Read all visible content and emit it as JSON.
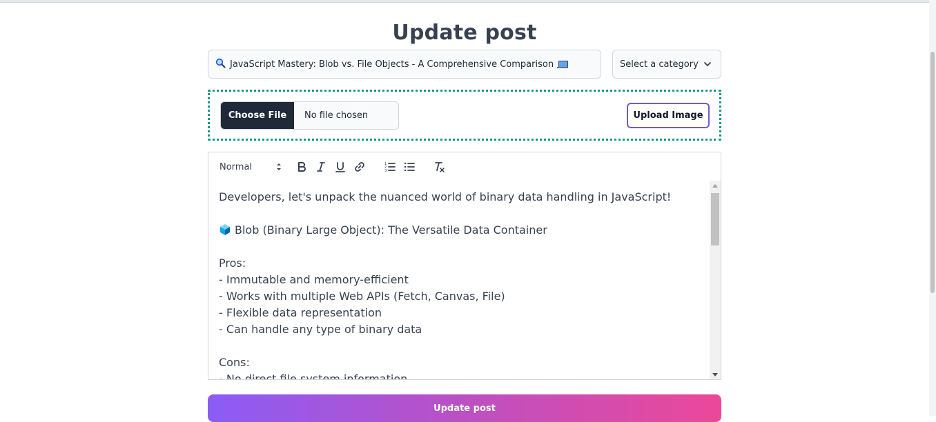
{
  "page": {
    "title": "Update post"
  },
  "post_form": {
    "title_value": "JavaScript Mastery: Blob vs. File Objects - A Comprehensive Comparison",
    "category_select": {
      "selected": "Select a category"
    },
    "image_upload": {
      "choose_file_label": "Choose File",
      "file_status": "No file chosen",
      "upload_button_label": "Upload Image",
      "border_color": "#14968a"
    },
    "editor": {
      "toolbar": {
        "format_picker_value": "Normal",
        "icons": [
          "bold-icon",
          "italic-icon",
          "underline-icon",
          "link-icon",
          "ordered-list-icon",
          "bullet-list-icon",
          "clean-format-icon"
        ]
      },
      "content": [
        "Developers, let's unpack the nuanced world of binary data handling in JavaScript!",
        "",
        "Blob (Binary Large Object): The Versatile Data Container",
        "",
        "Pros:",
        "- Immutable and memory-efficient",
        "- Works with multiple Web APIs (Fetch, Canvas, File)",
        "- Flexible data representation",
        "- Can handle any type of binary data",
        "",
        "Cons:",
        "- No direct file system information"
      ]
    },
    "submit_button_label": "Update post",
    "submit_gradient": [
      "#8b5cf6",
      "#ec4899"
    ]
  }
}
